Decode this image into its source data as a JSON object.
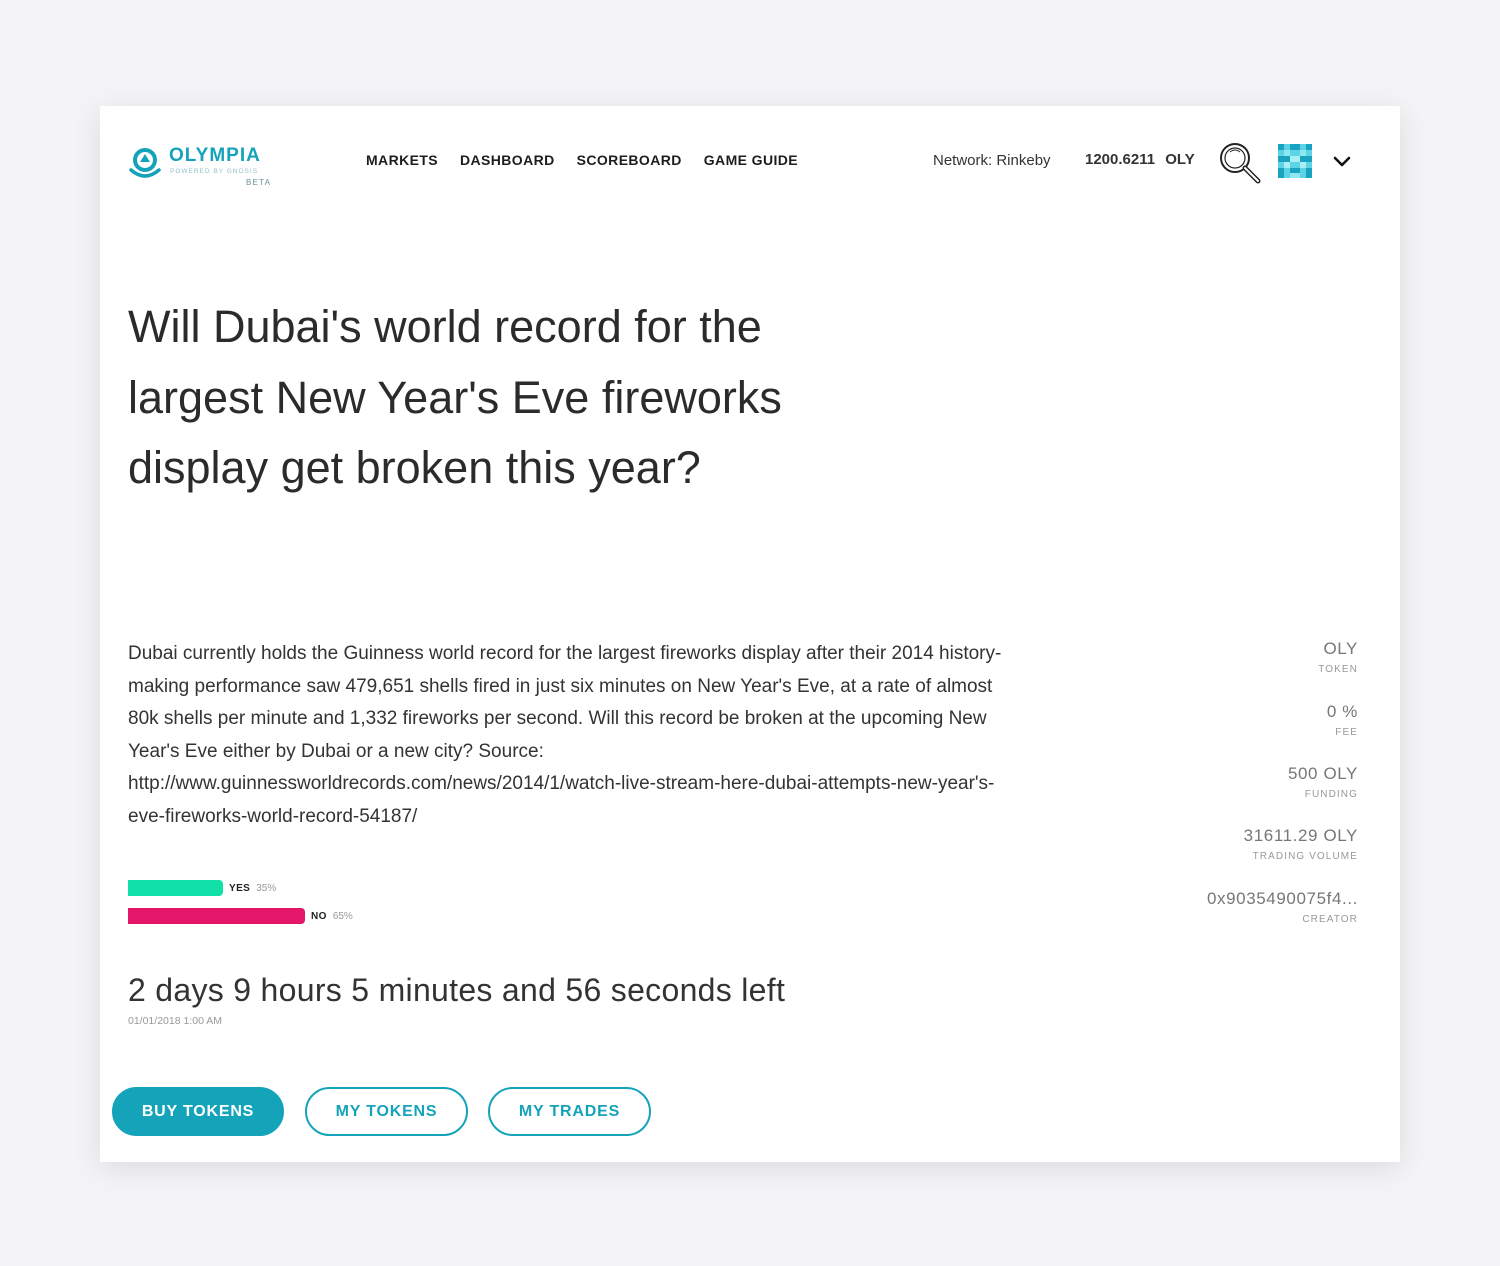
{
  "header": {
    "logo": {
      "name": "OLYMPIA",
      "tagline": "POWERED BY GNOSIS",
      "badge": "BETA"
    },
    "nav": [
      "MARKETS",
      "DASHBOARD",
      "SCOREBOARD",
      "GAME GUIDE"
    ],
    "network": "Network: Rinkeby",
    "balance": {
      "amount": "1200.6211",
      "unit": "OLY"
    },
    "icons": {
      "search": "search-icon",
      "avatar": "identicon-avatar",
      "menu": "chevron-down-icon"
    }
  },
  "market": {
    "title": "Will Dubai's world record for the largest New Year's Eve fireworks display get broken this year?",
    "description": "Dubai currently holds the Guinness world record for the largest fireworks display after their 2014 history-making performance saw 479,651 shells fired in just six minutes on New Year's Eve, at a rate of almost 80k shells per minute and 1,332 fireworks per second. Will this record be broken at the upcoming New Year's Eve either by Dubai or a new city? Source: http://www.guinnessworldrecords.com/news/2014/1/watch-live-stream-here-dubai-attempts-new-year's-eve-fireworks-world-record-54187/",
    "outcomes": [
      {
        "label": "YES",
        "percent": "35%",
        "share": 0.35,
        "color": "#11e0a8"
      },
      {
        "label": "NO",
        "percent": "65%",
        "share": 0.65,
        "color": "#e3166a"
      }
    ],
    "time_left": "2 days 9 hours 5 minutes and 56 seconds left",
    "resolution_date": "01/01/2018 1:00 AM",
    "stats": [
      {
        "value": "OLY",
        "key": "TOKEN"
      },
      {
        "value": "0 %",
        "key": "FEE"
      },
      {
        "value": "500 OLY",
        "key": "FUNDING"
      },
      {
        "value": "31611.29 OLY",
        "key": "TRADING VOLUME"
      },
      {
        "value": "0x9035490075f4...",
        "key": "CREATOR"
      }
    ]
  },
  "actions": {
    "buy": "BUY TOKENS",
    "my_tokens": "MY TOKENS",
    "my_trades": "MY TRADES"
  },
  "colors": {
    "accent": "#15a3ba",
    "yes": "#11e0a8",
    "no": "#e3166a",
    "background": "#f4f4f7"
  }
}
